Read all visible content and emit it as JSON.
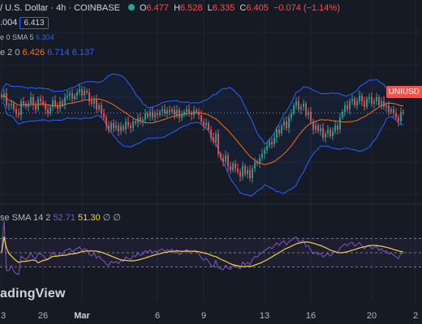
{
  "header": {
    "pair_title": "/ U.S. Dollar · 4h · COINBASE",
    "ohlc": [
      {
        "k": "O",
        "v": "6.477"
      },
      {
        "k": "H",
        "v": "6.528"
      },
      {
        "k": "L",
        "v": "6.335"
      },
      {
        "k": "C",
        "v": "6.405"
      }
    ],
    "change": "−0.074 (−1.14%)",
    "price_pill": "6.413",
    "price_pill_prefix": ".004",
    "sma_label": "e 0 SMA 5",
    "sma_value": "6.304",
    "bb_label": "e 2 0",
    "bb_values": [
      "6.426",
      "6.714",
      "6.137"
    ],
    "rsi_label": "se SMA 14 2",
    "rsi_values": [
      "52.71",
      "51.30"
    ],
    "rsi_suffix": "∅ ∅"
  },
  "price_tag": "UNIUSD",
  "logo": "adingView",
  "colors": {
    "background": "#161a25",
    "up": "#26a69a",
    "down": "#ef5350",
    "bb_band": "#2962ff",
    "bb_basis": "#ff6d00",
    "rsi": "#7e57c2",
    "rsi_ma": "#f5d142"
  },
  "chart_data": [
    {
      "type": "candlestick",
      "x_tick_labels": [
        "3",
        "26",
        "Mar",
        "6",
        "9",
        "13",
        "16",
        "20",
        "2"
      ],
      "x_tick_indices": [
        0,
        17,
        33,
        64,
        83,
        108,
        127,
        152,
        170
      ],
      "ylim": [
        5.4,
        7.3
      ],
      "last_price_line": 6.405,
      "series": [
        {
          "name": "candles",
          "close": [
            6.6,
            6.65,
            6.5,
            6.5,
            6.52,
            6.45,
            6.4,
            6.38,
            6.55,
            6.52,
            6.48,
            6.52,
            6.6,
            6.5,
            6.45,
            6.58,
            6.55,
            6.52,
            6.45,
            6.4,
            6.48,
            6.56,
            6.5,
            6.46,
            6.55,
            6.5,
            6.6,
            6.62,
            6.65,
            6.58,
            6.62,
            6.66,
            6.7,
            6.62,
            6.68,
            6.66,
            6.55,
            6.52,
            6.58,
            6.45,
            6.5,
            6.4,
            6.35,
            6.25,
            6.2,
            6.28,
            6.22,
            6.25,
            6.18,
            6.24,
            6.2,
            6.3,
            6.25,
            6.22,
            6.3,
            6.28,
            6.35,
            6.3,
            6.32,
            6.4,
            6.36,
            6.42,
            6.35,
            6.4,
            6.38,
            6.42,
            6.45,
            6.4,
            6.44,
            6.42,
            6.45,
            6.38,
            6.44,
            6.35,
            6.38,
            6.42,
            6.45,
            6.4,
            6.38,
            6.44,
            6.42,
            6.38,
            6.3,
            6.25,
            6.28,
            6.2,
            6.1,
            6.05,
            6.15,
            5.9,
            5.85,
            5.8,
            5.88,
            5.75,
            5.7,
            5.78,
            5.72,
            5.68,
            5.62,
            5.75,
            5.65,
            5.7,
            5.6,
            5.72,
            5.8,
            5.78,
            5.85,
            5.9,
            5.95,
            6.0,
            6.05,
            6.02,
            6.1,
            6.2,
            6.15,
            6.25,
            6.3,
            6.22,
            6.35,
            6.4,
            6.5,
            6.55,
            6.45,
            6.48,
            6.52,
            6.38,
            6.42,
            6.3,
            6.2,
            6.25,
            6.18,
            6.22,
            6.1,
            6.15,
            6.2,
            6.12,
            6.18,
            6.25,
            6.2,
            6.35,
            6.42,
            6.5,
            6.45,
            6.55,
            6.58,
            6.5,
            6.55,
            6.62,
            6.55,
            6.48,
            6.58,
            6.6,
            6.52,
            6.55,
            6.6,
            6.5,
            6.55,
            6.48,
            6.5,
            6.42,
            6.45,
            6.4,
            6.35,
            6.3,
            6.42,
            6.405
          ]
        },
        {
          "name": "SMA 5 basis",
          "values": "derived"
        },
        {
          "name": "BB upper",
          "values": "derived"
        },
        {
          "name": "BB lower",
          "values": "derived"
        }
      ]
    },
    {
      "type": "line",
      "ylim": [
        0,
        100
      ],
      "levels": [
        70,
        50,
        30
      ],
      "series": [
        {
          "name": "RSI 14",
          "values": "derived"
        },
        {
          "name": "RSI SMA",
          "values": "derived"
        }
      ]
    }
  ]
}
